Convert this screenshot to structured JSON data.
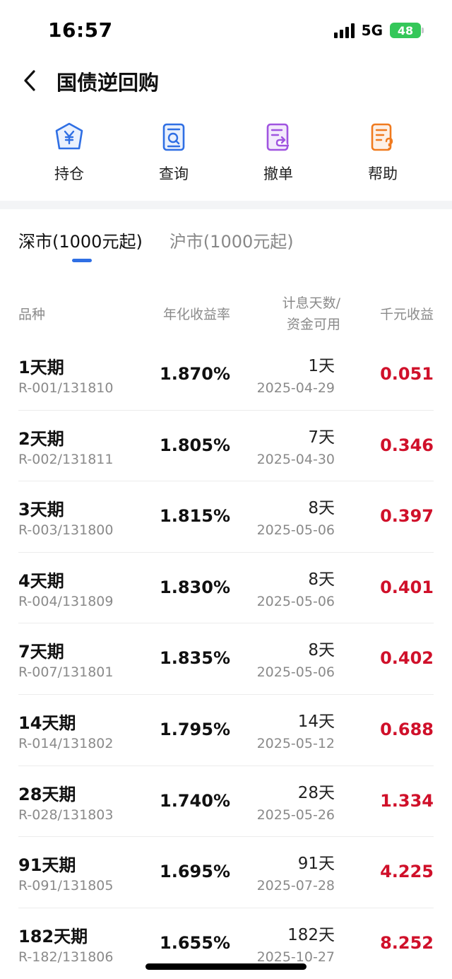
{
  "status_bar": {
    "time": "16:57",
    "network": "5G",
    "battery": "48"
  },
  "nav": {
    "title": "国债逆回购"
  },
  "actions": [
    {
      "label": "持仓",
      "icon": "yen-shield-icon",
      "color": "#2f6fe4"
    },
    {
      "label": "查询",
      "icon": "search-document-icon",
      "color": "#2f6fe4"
    },
    {
      "label": "撤单",
      "icon": "undo-document-icon",
      "color": "#a054e0"
    },
    {
      "label": "帮助",
      "icon": "help-document-icon",
      "color": "#f07a1e"
    }
  ],
  "tabs": [
    {
      "label": "深市(1000元起)",
      "active": true
    },
    {
      "label": "沪市(1000元起)",
      "active": false
    }
  ],
  "table": {
    "headers": {
      "variety": "品种",
      "rate": "年化收益率",
      "days_line1": "计息天数/",
      "days_line2": "资金可用",
      "yield": "千元收益"
    },
    "rows": [
      {
        "name": "1天期",
        "code": "R-001/131810",
        "rate": "1.870%",
        "days": "1天",
        "date": "2025-04-29",
        "yield": "0.051"
      },
      {
        "name": "2天期",
        "code": "R-002/131811",
        "rate": "1.805%",
        "days": "7天",
        "date": "2025-04-30",
        "yield": "0.346"
      },
      {
        "name": "3天期",
        "code": "R-003/131800",
        "rate": "1.815%",
        "days": "8天",
        "date": "2025-05-06",
        "yield": "0.397"
      },
      {
        "name": "4天期",
        "code": "R-004/131809",
        "rate": "1.830%",
        "days": "8天",
        "date": "2025-05-06",
        "yield": "0.401"
      },
      {
        "name": "7天期",
        "code": "R-007/131801",
        "rate": "1.835%",
        "days": "8天",
        "date": "2025-05-06",
        "yield": "0.402"
      },
      {
        "name": "14天期",
        "code": "R-014/131802",
        "rate": "1.795%",
        "days": "14天",
        "date": "2025-05-12",
        "yield": "0.688"
      },
      {
        "name": "28天期",
        "code": "R-028/131803",
        "rate": "1.740%",
        "days": "28天",
        "date": "2025-05-26",
        "yield": "1.334"
      },
      {
        "name": "91天期",
        "code": "R-091/131805",
        "rate": "1.695%",
        "days": "91天",
        "date": "2025-07-28",
        "yield": "4.225"
      },
      {
        "name": "182天期",
        "code": "R-182/131806",
        "rate": "1.655%",
        "days": "182天",
        "date": "2025-10-27",
        "yield": "8.252"
      }
    ]
  },
  "colors": {
    "accent": "#2f6fe4",
    "yield_red": "#d0102a",
    "battery_green": "#34c759"
  }
}
